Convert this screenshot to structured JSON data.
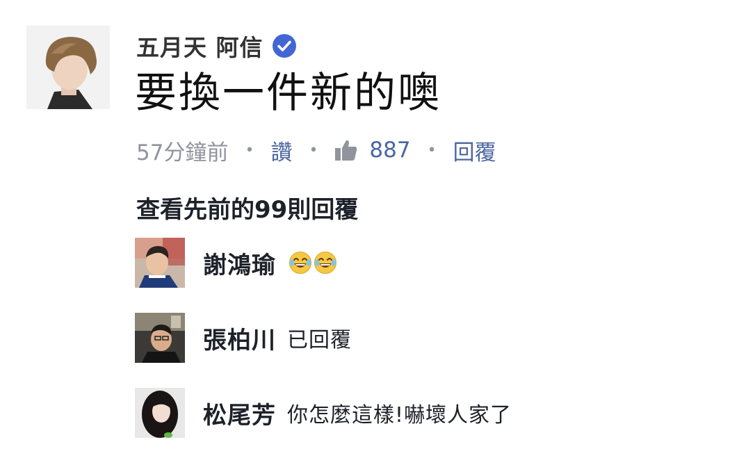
{
  "post": {
    "author": "五月天 阿信",
    "verified_icon": "verified-check-icon",
    "text": "要換一件新的噢",
    "avatar_icon": "profile-photo-avatar"
  },
  "meta": {
    "time": "57分鐘前",
    "separator": "•",
    "like_label": "讚",
    "like_icon": "thumbs-up-icon",
    "like_count": "887",
    "reply_label": "回覆"
  },
  "replies": {
    "view_previous": "查看先前的99則回覆"
  },
  "comments": [
    {
      "name": "謝鴻瑜",
      "text": "",
      "emoji": "laughing-tears-emoji"
    },
    {
      "name": "張柏川",
      "text": "已回覆"
    },
    {
      "name": "松尾芳",
      "text": "你怎麼這樣!嚇壞人家了"
    }
  ],
  "colors": {
    "link": "#4b67a1",
    "muted": "#90949c",
    "verified": "#4267d5",
    "text": "#1d2129"
  }
}
